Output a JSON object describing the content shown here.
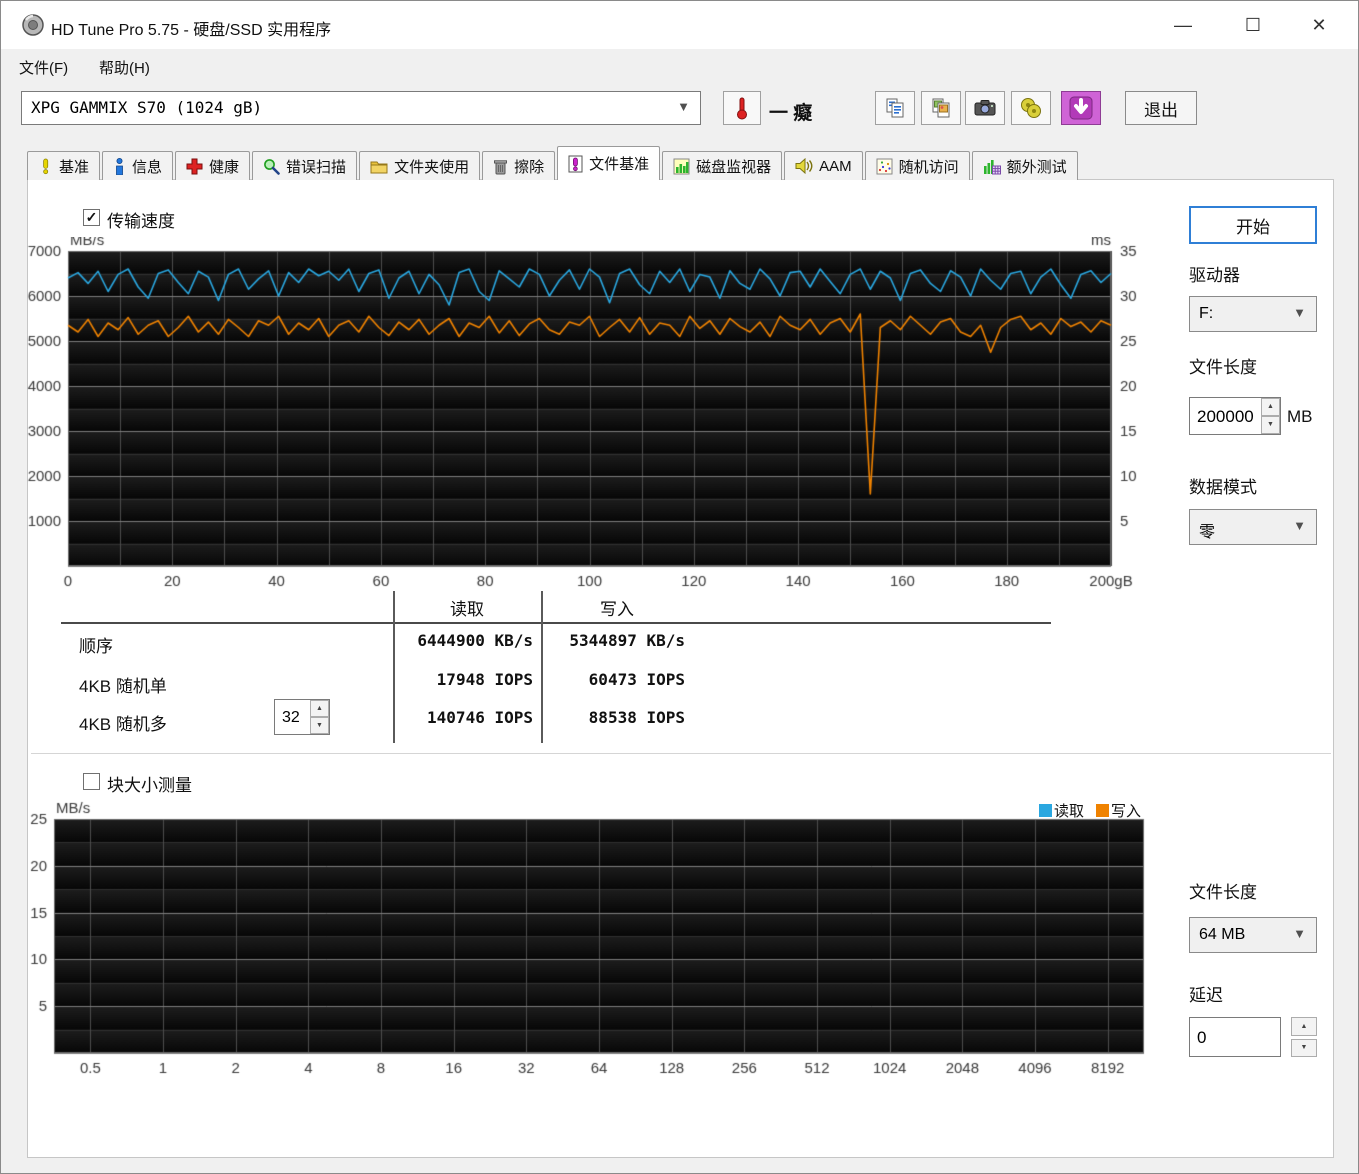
{
  "window": {
    "title": "HD Tune Pro 5.75 - 硬盘/SSD 实用程序",
    "minimize": "—",
    "maximize": "☐",
    "close": "✕"
  },
  "menu": {
    "file": "文件(F)",
    "help": "帮助(H)"
  },
  "toolbar": {
    "drive_select": "XPG GAMMIX S70 (1024 gB)",
    "temperature_text": "一 癡",
    "exit_label": "退出"
  },
  "tabs": {
    "items": [
      {
        "label": "基准"
      },
      {
        "label": "信息"
      },
      {
        "label": "健康"
      },
      {
        "label": "错误扫描"
      },
      {
        "label": "文件夹使用"
      },
      {
        "label": "擦除"
      },
      {
        "label": "文件基准",
        "selected": true
      },
      {
        "label": "磁盘监视器"
      },
      {
        "label": "AAM"
      },
      {
        "label": "随机访问"
      },
      {
        "label": "额外测试"
      }
    ]
  },
  "panel": {
    "transfer_speed": {
      "label": "传输速度",
      "checked": true
    },
    "start_button": "开始",
    "drive": {
      "label": "驱动器",
      "value": "F:"
    },
    "file_length": {
      "label": "文件长度",
      "value": "200000",
      "unit": "MB"
    },
    "data_mode": {
      "label": "数据模式",
      "value": "零"
    },
    "results": {
      "col_read": "读取",
      "col_write": "写入",
      "queue_depth": "32",
      "rows": [
        {
          "label": "顺序",
          "read": "6444900 KB/s",
          "write": "5344897 KB/s"
        },
        {
          "label": "4KB 随机单",
          "read": "17948 IOPS",
          "write": "60473 IOPS"
        },
        {
          "label": "4KB 随机多",
          "read": "140746 IOPS",
          "write": "88538 IOPS"
        }
      ]
    },
    "block_size": {
      "label": "块大小测量",
      "checked": false
    },
    "file_length2": {
      "label": "文件长度",
      "value": "64 MB"
    },
    "delay": {
      "label": "延迟",
      "value": "0"
    }
  },
  "chart_data": [
    {
      "type": "line",
      "title": "传输速度 (transfer speed)",
      "ylabel": "MB/s",
      "y2label": "ms",
      "ylim": [
        0,
        7000
      ],
      "ytick_step": 1000,
      "yminor_step": 500,
      "y2lim": [
        0,
        35
      ],
      "y2tick_step": 5,
      "x_range": [
        0,
        200
      ],
      "xticks": [
        0,
        20,
        40,
        60,
        80,
        100,
        120,
        140,
        160,
        180,
        200
      ],
      "xtick_labels": [
        "0",
        "20",
        "40",
        "60",
        "80",
        "100",
        "120",
        "140",
        "160",
        "180",
        "200gB"
      ],
      "grid": true,
      "series": [
        {
          "name": "读取",
          "color": "#2aa7e0",
          "values": [
            6400,
            6520,
            6280,
            6550,
            6100,
            6480,
            6600,
            6200,
            5950,
            6500,
            6580,
            6300,
            6050,
            6550,
            6420,
            5900,
            6480,
            6600,
            6150,
            6380,
            6560,
            6000,
            6520,
            6300,
            6600,
            6450,
            6550,
            6350,
            6600,
            6100,
            6500,
            6580,
            5950,
            6400,
            6550,
            6050,
            6480,
            6250,
            5800,
            6520,
            6600,
            6100,
            5900,
            6560,
            6380,
            6200,
            6600,
            6480,
            6000,
            6350,
            6580,
            6150,
            6600,
            6420,
            5850,
            6500,
            6600,
            6250,
            6050,
            6550,
            6300,
            6600,
            6100,
            6480,
            6420,
            5950,
            6560,
            6280,
            6150,
            6600,
            6380,
            6000,
            6520,
            6550,
            6200,
            6600,
            6320,
            6050,
            6480,
            6600,
            6150,
            6550,
            6400,
            5900,
            6500,
            6580,
            6280,
            6100,
            6560,
            6420,
            6000,
            6600,
            6350,
            6150,
            6500,
            6550,
            6050,
            6420,
            6600,
            6250,
            5950,
            6480,
            6560,
            6300,
            6500
          ]
        },
        {
          "name": "写入",
          "color": "#ef8200",
          "values": [
            5350,
            5200,
            5480,
            5100,
            5400,
            5250,
            5520,
            5150,
            5350,
            5450,
            5100,
            5300,
            5550,
            5200,
            5420,
            5150,
            5480,
            5300,
            5100,
            5450,
            5350,
            5550,
            5150,
            5400,
            5250,
            5500,
            5100,
            5350,
            5450,
            5200,
            5550,
            5300,
            5120,
            5420,
            5250,
            5480,
            5150,
            5350,
            5500,
            5100,
            5400,
            5300,
            5550,
            5180,
            5450,
            5120,
            5380,
            5500,
            5250,
            5150,
            5420,
            5350,
            5550,
            5100,
            5300,
            5480,
            5200,
            5520,
            5150,
            5400,
            5350,
            5100,
            5550,
            5280,
            5450,
            5150,
            5500,
            5320,
            5200,
            5420,
            5100,
            5550,
            5350,
            5250,
            5480,
            5150,
            5400,
            5500,
            5200,
            5600,
            1600,
            5300,
            5450,
            5250,
            5550,
            5350,
            5150,
            5420,
            5500,
            5200,
            5100,
            5350,
            4750,
            5300,
            5480,
            5550,
            5250,
            5400,
            5150,
            5500,
            5320,
            5420,
            5200,
            5450,
            5350
          ]
        }
      ]
    },
    {
      "type": "line",
      "title": "块大小测量 (block size measurement)",
      "ylabel": "MB/s",
      "ylim": [
        0,
        25
      ],
      "ytick_step": 5,
      "yminor_step": 2.5,
      "xtick_labels": [
        "0.5",
        "1",
        "2",
        "4",
        "8",
        "16",
        "32",
        "64",
        "128",
        "256",
        "512",
        "1024",
        "2048",
        "4096",
        "8192"
      ],
      "grid": true,
      "legend": [
        {
          "label": "读取",
          "color": "#2aa7e0"
        },
        {
          "label": "写入",
          "color": "#ef8200"
        }
      ],
      "series": []
    }
  ]
}
